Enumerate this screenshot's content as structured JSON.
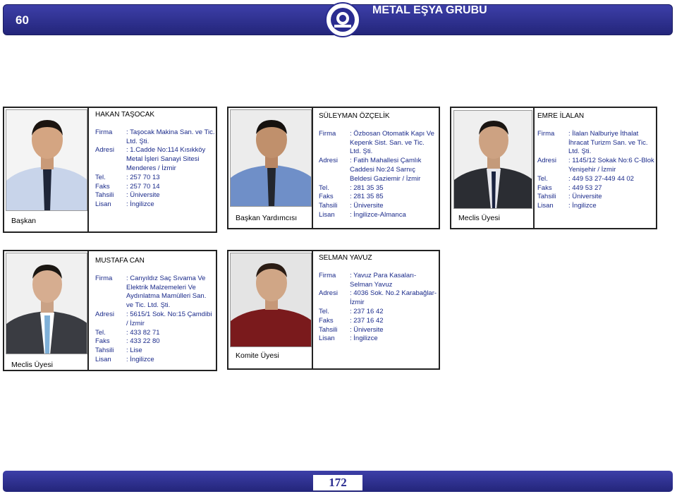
{
  "header": {
    "page_number": "60",
    "group_title": "METAL EŞYA GRUBU"
  },
  "footer": {
    "page_number": "172"
  },
  "members": [
    {
      "name": "HAKAN TAŞOCAK",
      "role": "Başkan",
      "lines": [
        [
          "Firma",
          ": Taşocak Makina San. ve Tic. Ltd. Şti."
        ],
        [
          "Adresi",
          ": 1.Cadde No:114 Kısıkköy Metal İşleri Sanayi Sitesi Menderes / İzmir"
        ],
        [
          "Tel.",
          ": 257 70 13"
        ],
        [
          "Faks",
          ": 257 70 14"
        ],
        [
          "Tahsili",
          ": Üniversite"
        ],
        [
          "Lisan",
          ": İngilizce"
        ]
      ]
    },
    {
      "name": "SÜLEYMAN ÖZÇELİK",
      "role": "Başkan Yardımcısı",
      "lines": [
        [
          "Firma",
          ": Özbosan Otomatik Kapı Ve Kepenk Sist. San. ve Tic. Ltd. Şti."
        ],
        [
          "Adresi",
          ": Fatih Mahallesi Çamlık Caddesi No:24 Sarnıç Beldesi Gaziemir / İzmir"
        ],
        [
          "Tel.",
          ": 281 35 35"
        ],
        [
          "Faks",
          ": 281 35 85"
        ],
        [
          "Tahsili",
          ": Üniversite"
        ],
        [
          "Lisan",
          ": İngilizce-Almanca"
        ]
      ]
    },
    {
      "name": "EMRE İLALAN",
      "role": "Meclis Üyesi",
      "lines": [
        [
          "Firma",
          ": İlalan Nalburiye İthalat İhracat Turizm San. ve Tic. Ltd. Şti."
        ],
        [
          "Adresi",
          ": 1145/12 Sokak No:6 C-Blok Yenişehir / İzmir"
        ],
        [
          "Tel.",
          ": 449 53 27-449 44 02"
        ],
        [
          "Faks",
          ": 449 53 27"
        ],
        [
          "Tahsili",
          ": Üniversite"
        ],
        [
          "Lisan",
          ": İngilizce"
        ]
      ]
    },
    {
      "name": "MUSTAFA CAN",
      "role": "Meclis Üyesi",
      "lines": [
        [
          "Firma",
          ": Canyıldız Saç Sıvama Ve Elektrik Malzemeleri Ve Aydınlatma Mamülleri San. ve Tic. Ltd. Şti."
        ],
        [
          "Adresi",
          ": 5615/1 Sok. No:15 Çamdibi / İzmir"
        ],
        [
          "Tel.",
          ": 433 82 71"
        ],
        [
          "Faks",
          ": 433 22 80"
        ],
        [
          "Tahsili",
          ": Lise"
        ],
        [
          "Lisan",
          ": İngilizce"
        ]
      ]
    },
    {
      "name": "SELMAN YAVUZ",
      "role": "Komite Üyesi",
      "lines": [
        [
          "Firma",
          ": Yavuz Para Kasaları-Selman Yavuz"
        ],
        [
          "Adresi",
          ": 4036 Sok. No.2 Karabağlar-İzmir"
        ],
        [
          "Tel.",
          ": 237 16 42"
        ],
        [
          "Faks",
          ": 237 16 42"
        ],
        [
          "Tahsili",
          ": Üniversite"
        ],
        [
          "Lisan",
          ": İngilizce"
        ]
      ]
    }
  ]
}
